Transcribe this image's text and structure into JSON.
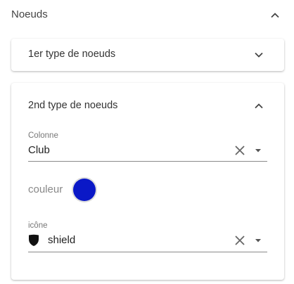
{
  "section": {
    "title": "Noeuds",
    "icon": "chevron-up-icon"
  },
  "panel1": {
    "title": "1er type de noeuds",
    "icon": "chevron-down-icon"
  },
  "panel2": {
    "title": "2nd type de noeuds",
    "icon": "chevron-up-icon",
    "colonne": {
      "label": "Colonne",
      "value": "Club"
    },
    "couleur": {
      "label": "couleur",
      "color": "#0a18c7"
    },
    "icone": {
      "label": "icône",
      "value": "shield",
      "icon": "shield-icon"
    }
  }
}
